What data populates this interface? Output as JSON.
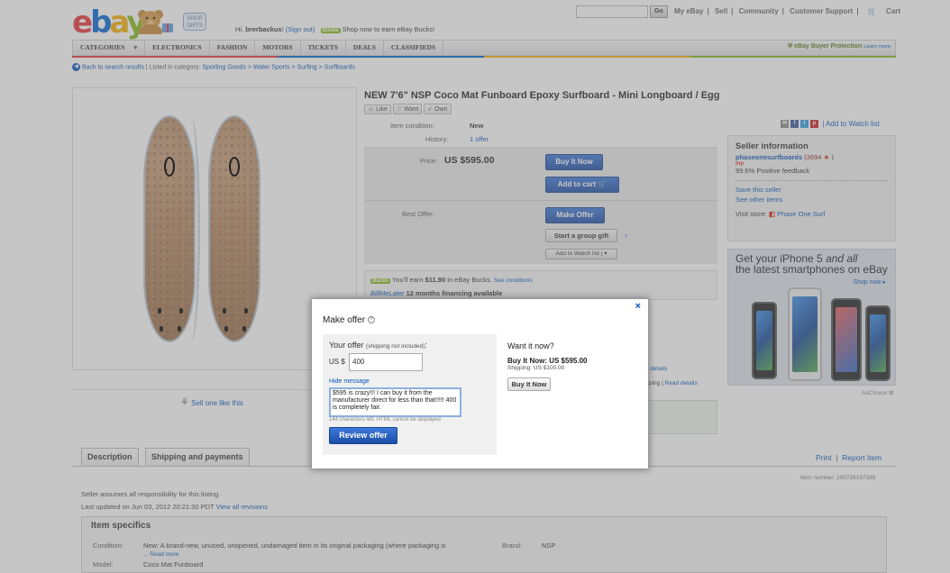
{
  "header": {
    "shop_gifts": "SHOP GIFTS",
    "greeting_prefix": "Hi, ",
    "username": "brerbackus",
    "greeting_suffix": "!",
    "sign_out": "(Sign out)",
    "bucks_badge": "Bucks",
    "bucks_text": "Shop now to earn eBay Bucks!",
    "go": "Go",
    "my_ebay": "My eBay",
    "sell": "Sell",
    "community": "Community",
    "support": "Customer Support",
    "cart": "Cart"
  },
  "nav": {
    "items": [
      "CATEGORIES",
      "ELECTRONICS",
      "FASHION",
      "MOTORS",
      "TICKETS",
      "DEALS",
      "CLASSIFIEDS"
    ],
    "protection": "eBay Buyer Protection",
    "protection_learn": "Learn more"
  },
  "breadcrumb": {
    "back": "Back to search results",
    "listed_in": "| Listed in category:",
    "path": "Sporting Goods > Water Sports > Surfing > Surfboards"
  },
  "listing": {
    "title": "NEW 7'6\" NSP Coco Mat Funboard Epoxy Surfboard - Mini Longboard / Egg",
    "like": "Like",
    "want": "Want",
    "own": "Own",
    "condition_label": "Item condition:",
    "condition_value": "New",
    "history_label": "History:",
    "history_value": "1 offer",
    "price_label": "Price:",
    "price_value": "US $595.00",
    "buy_it_now": "Buy It Now",
    "add_to_cart": "Add to cart",
    "best_offer_label": "Best Offer:",
    "make_offer": "Make Offer",
    "group_gift": "Start a group gift",
    "add_watch": "Add to Watch list",
    "bucks_line_prefix": "You'll earn ",
    "bucks_amount": "$11.90",
    "bucks_line_suffix": " in eBay Bucks.",
    "see_conditions": "See conditions",
    "billme": "BillMeLater",
    "financing": "12 months financing available",
    "details_frag": "e details",
    "ping_frag": "ping |",
    "read_details": "Read details",
    "sell_one": "Sell one like this"
  },
  "seller": {
    "watch_link": "| Add to Watch list",
    "heading": "Seller information",
    "name": "phaseonesurfboards",
    "score": "(3694",
    "score_end": ")",
    "mp": "mp",
    "feedback": "99.6% Positive feedback",
    "save": "Save this seller",
    "other": "See other items",
    "visit_store": "Visit store:",
    "store_name": "Phase One Surf"
  },
  "ad": {
    "line1": "Get your iPhone 5",
    "line1b": "and all",
    "line2": "the latest smartphones on eBay",
    "shop_now": "Shop now",
    "adchoice": "AdChoice"
  },
  "tabs": {
    "description": "Description",
    "shipping": "Shipping and payments",
    "print": "Print",
    "report": "Report item",
    "item_number": "Item number:  200726197389"
  },
  "desc": {
    "responsibility": "Seller assumes all responsibility for this listing.",
    "updated": "Last updated on  Jun 03, 2012 20:21:30 PDT",
    "revisions": "View all revisions",
    "specifics": "Item specifics",
    "condition_label": "Condition:",
    "condition_value": "New: A brand-new, unused, unopened, undamaged item in its original packaging (where packaging is",
    "read_more": "... Read more",
    "brand_label": "Brand:",
    "brand_value": "NSP",
    "model_label": "Model:",
    "model_value": "Coco Mat Funboard"
  },
  "modal": {
    "title": "Make offer",
    "close": "×",
    "your_offer": "Your offer",
    "shipping_note": "(shipping not included)",
    "colon": ":",
    "currency": "US $",
    "offer_value": "400",
    "hide_message": "Hide message",
    "message": "$595 is crazy!!! I can buy it from the manufacturer direct for less than that!!!!! 400 is completely fair.",
    "chars_left": "144 characters left. HTML cannot be displayed",
    "review": "Review offer",
    "want_now": "Want it now?",
    "buy_now_price": "Buy It Now: US $595.00",
    "shipping_price": "Shipping: US $100.00",
    "buy_now_button": "Buy It Now"
  }
}
